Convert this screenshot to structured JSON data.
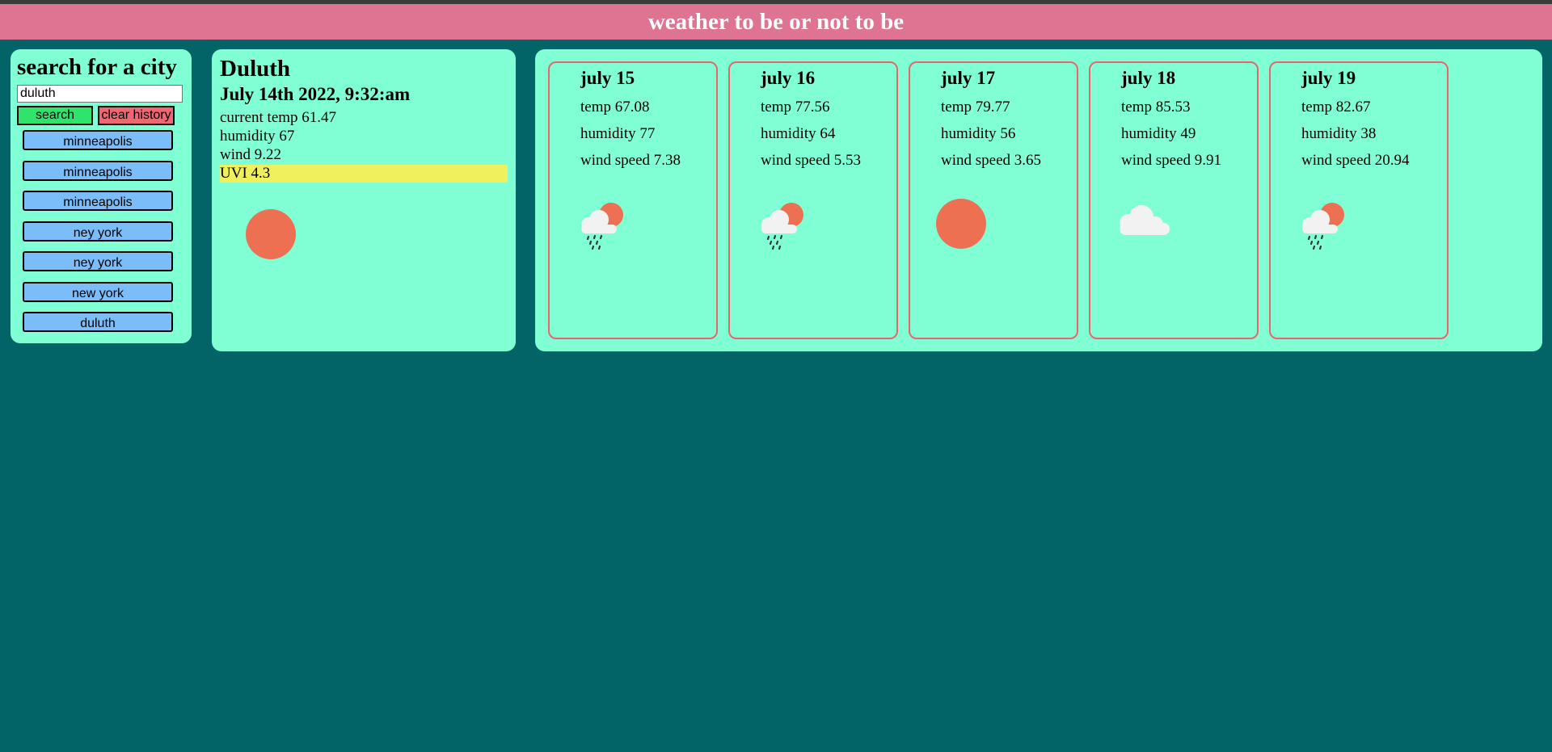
{
  "header": {
    "title": "weather to be or not to be"
  },
  "search": {
    "title": "search for a city",
    "input_value": "duluth",
    "search_label": "search",
    "clear_label": "clear history",
    "history": [
      "minneapolis",
      "minneapolis",
      "minneapolis",
      "ney york",
      "ney york",
      "new york",
      "duluth"
    ]
  },
  "current": {
    "city": "Duluth",
    "date": "July 14th 2022, 9:32:am",
    "temp": "current temp 61.47",
    "humidity": "humidity 67",
    "wind": "wind 9.22",
    "uvi": "UVI 4.3",
    "icon": "sun-icon"
  },
  "forecast": [
    {
      "date": "july 15",
      "temp": "temp 67.08",
      "humidity": "humidity 77",
      "wind": "wind speed 7.38",
      "icon": "sun-cloud-rain-icon"
    },
    {
      "date": "july 16",
      "temp": "temp 77.56",
      "humidity": "humidity 64",
      "wind": "wind speed 5.53",
      "icon": "sun-cloud-rain-icon"
    },
    {
      "date": "july 17",
      "temp": "temp 79.77",
      "humidity": "humidity 56",
      "wind": "wind speed 3.65",
      "icon": "sun-icon"
    },
    {
      "date": "july 18",
      "temp": "temp 85.53",
      "humidity": "humidity 49",
      "wind": "wind speed 9.91",
      "icon": "cloud-icon"
    },
    {
      "date": "july 19",
      "temp": "temp 82.67",
      "humidity": "humidity 38",
      "wind": "wind speed 20.94",
      "icon": "sun-cloud-rain-icon"
    }
  ],
  "colors": {
    "background": "#026466",
    "header": "#de7491",
    "panel": "#80ffd4",
    "search_button": "#2fe36b",
    "clear_button": "#ef6770",
    "history_button": "#7bbdf8",
    "uvi_highlight": "#f0f05d",
    "sun": "#ee7052",
    "card_border": "#e8666b"
  }
}
